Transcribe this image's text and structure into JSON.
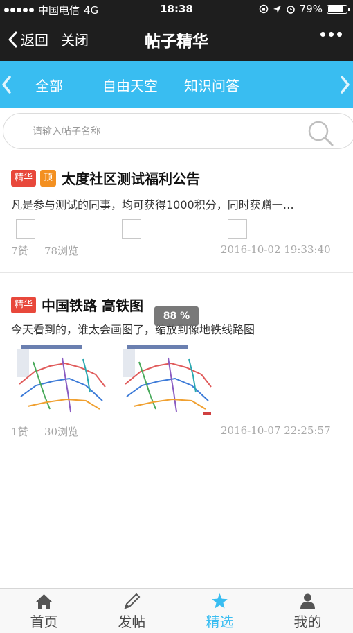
{
  "status_bar": {
    "carrier": "中国电信",
    "network": "4G",
    "time": "18:38",
    "battery": "79%",
    "battery_level": 0.79
  },
  "nav": {
    "back_label": "返回",
    "close_label": "关闭",
    "title": "帖子精华",
    "more_icon": "more-dots-icon"
  },
  "tabs": {
    "items": [
      "全部",
      "自由天空",
      "知识问答"
    ],
    "left_arrow_icon": "chevron-left-icon",
    "right_arrow_icon": "chevron-right-icon"
  },
  "search": {
    "placeholder": "请输入帖子名称",
    "icon": "search-icon"
  },
  "posts": [
    {
      "badges": [
        "精华",
        "顶"
      ],
      "title": "太度社区测试福利公告",
      "excerpt": "凡是参与测试的同事，均可获得1000积分，同时获赠一…",
      "likes": "7赞",
      "views": "78浏览",
      "date": "2016-10-02 19:33:40"
    },
    {
      "badges": [
        "精华"
      ],
      "title": "中国铁路 高铁图",
      "excerpt": "今天看到的，谁太会画图了，缩放到像地铁线路图",
      "likes": "1赞",
      "views": "30浏览",
      "date": "2016-10-07 22:25:57"
    }
  ],
  "zoom_toast": "88 %",
  "bottom_nav": {
    "items": [
      {
        "label": "首页",
        "icon": "home-icon"
      },
      {
        "label": "发帖",
        "icon": "pencil-icon"
      },
      {
        "label": "精选",
        "icon": "star-icon"
      },
      {
        "label": "我的",
        "icon": "user-icon"
      }
    ],
    "active_index": 2
  },
  "colors": {
    "accent": "#39bdf1",
    "badge_red": "#e8483b",
    "badge_orange": "#f39021",
    "bar_dark": "#1e1e1e"
  }
}
